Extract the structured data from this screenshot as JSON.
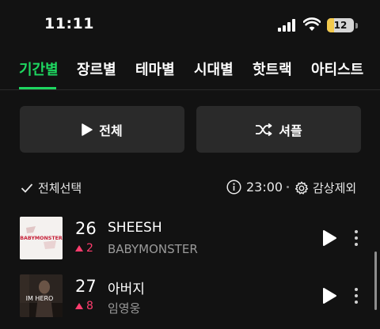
{
  "status_bar": {
    "time": "11:11",
    "battery_percent": "12"
  },
  "tabs": [
    {
      "label": "기간별",
      "active": true
    },
    {
      "label": "장르별",
      "active": false
    },
    {
      "label": "테마별",
      "active": false
    },
    {
      "label": "시대별",
      "active": false
    },
    {
      "label": "핫트랙",
      "active": false
    },
    {
      "label": "아티스트",
      "active": false
    }
  ],
  "actions": {
    "play_all_label": "전체",
    "shuffle_label": "셔플"
  },
  "list_controls": {
    "select_all_label": "전체선택",
    "time": "23:00",
    "exclude_label": "감상제외"
  },
  "songs": [
    {
      "rank": "26",
      "change": "2",
      "change_direction": "up",
      "title": "SHEESH",
      "artist": "BABYMONSTER",
      "album_art_text": "BABYMONSTER"
    },
    {
      "rank": "27",
      "change": "8",
      "change_direction": "up",
      "title": "아버지",
      "artist": "임영웅",
      "album_art_text": "IM HERO"
    }
  ],
  "colors": {
    "accent": "#1ed760",
    "rank_up": "#ff3d6e",
    "background": "#121212",
    "button_bg": "#2a2a2a"
  }
}
